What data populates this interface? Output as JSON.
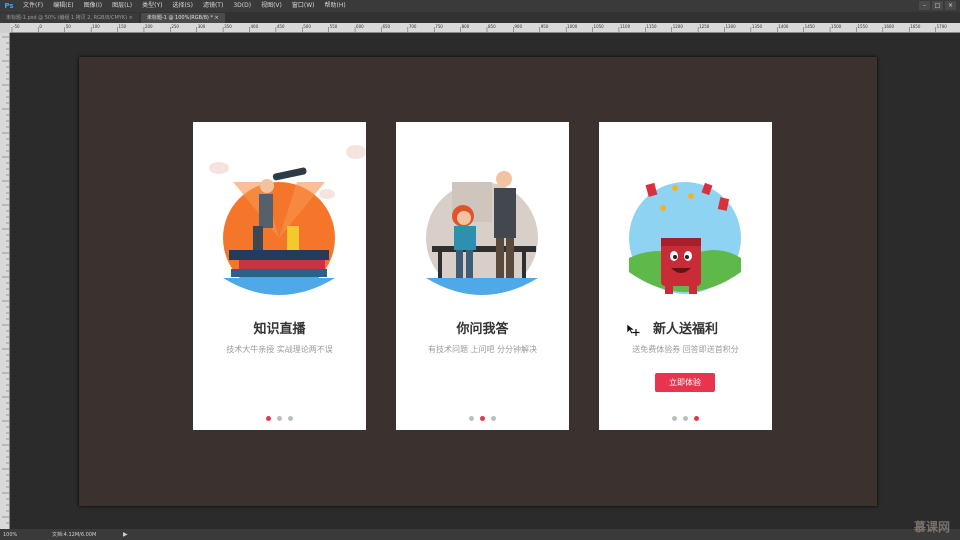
{
  "app": {
    "logo": "Ps",
    "menu": [
      "文件(F)",
      "编辑(E)",
      "图像(I)",
      "图层(L)",
      "类型(Y)",
      "选择(S)",
      "滤镜(T)",
      "3D(D)",
      "视图(V)",
      "窗口(W)",
      "帮助(H)"
    ],
    "window_controls": [
      "minimize-icon",
      "restore-icon",
      "close-icon"
    ]
  },
  "tabs": [
    {
      "label": "未标题-1.psd @ 50% (编组 1 拷贝 2, RGB/8/CMYK) ×",
      "active": false
    },
    {
      "label": "未标题-1 @ 100%(RGB/8) * ×",
      "active": true
    }
  ],
  "ruler_ticks": [
    "-50",
    "0",
    "50",
    "100",
    "150",
    "200",
    "250",
    "300",
    "350",
    "400",
    "450",
    "500",
    "550",
    "600",
    "650",
    "700",
    "750",
    "800",
    "850",
    "900",
    "950",
    "1000",
    "1050",
    "1100",
    "1150",
    "1200",
    "1250",
    "1300",
    "1350",
    "1400",
    "1450",
    "1500",
    "1550",
    "1600",
    "1650",
    "1700"
  ],
  "cards": [
    {
      "title": "知识直播",
      "subtitle": "技术大牛亲授 实战理论两不误",
      "active_dot": 0,
      "button": null,
      "illustration": "telescope-man-illustration"
    },
    {
      "title": "你问我答",
      "subtitle": "有技术问题 上问吧 分分钟解决",
      "active_dot": 1,
      "button": null,
      "illustration": "teacher-student-illustration"
    },
    {
      "title": "新人送福利",
      "subtitle": "送免费体验券 回答即送首积分",
      "active_dot": 2,
      "button": "立即体验",
      "illustration": "red-packet-character-illustration"
    }
  ],
  "status": {
    "zoom": "100%",
    "doc_info": "文档:4.12M/6.00M"
  },
  "watermark": "慕课网",
  "colors": {
    "accent": "#e8344f",
    "canvas": "#3b3230",
    "card": "#ffffff",
    "orange": "#f5762b",
    "blue": "#4fa8e8"
  }
}
